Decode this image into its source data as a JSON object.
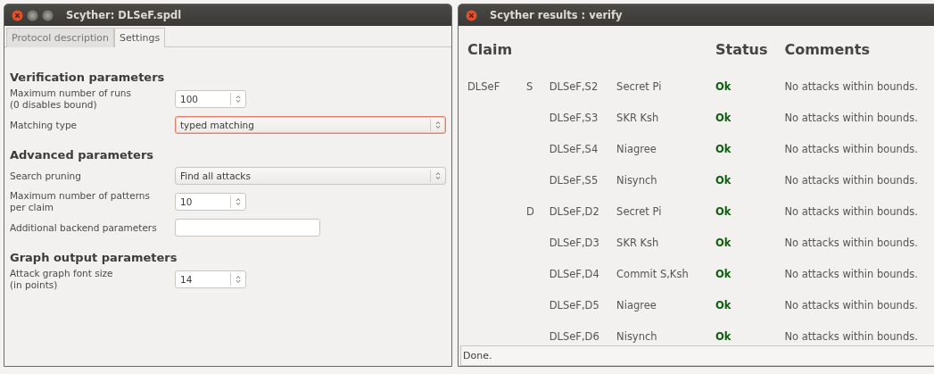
{
  "settings_window": {
    "title": "Scyther: DLSeF.spdl",
    "tabs": [
      {
        "label": "Protocol description",
        "selected": false
      },
      {
        "label": "Settings",
        "selected": true
      }
    ],
    "sections": [
      {
        "heading": "Verification parameters",
        "fields": [
          {
            "label": "Maximum number of runs\n(0 disables bound)",
            "kind": "spin",
            "value": "100",
            "focused": false
          },
          {
            "label": "Matching type",
            "kind": "combo",
            "value": "typed matching",
            "focused": true
          }
        ]
      },
      {
        "heading": "Advanced parameters",
        "fields": [
          {
            "label": "Search pruning",
            "kind": "combo",
            "value": "Find all attacks",
            "focused": false
          },
          {
            "label": "Maximum number of patterns\nper claim",
            "kind": "spin",
            "value": "10",
            "focused": false
          },
          {
            "label": "Additional backend parameters",
            "kind": "text",
            "focused": false
          }
        ]
      },
      {
        "heading": "Graph output parameters",
        "fields": [
          {
            "label": "Attack graph font size\n(in points)",
            "kind": "spin",
            "value": "14",
            "focused": false
          }
        ]
      }
    ]
  },
  "results_window": {
    "title": "Scyther results : verify",
    "columns": [
      "Claim",
      "Status",
      "Comments"
    ],
    "rows": [
      {
        "protocol": "DLSeF",
        "role": "S",
        "claim_id": "DLSeF,S2",
        "claim": "Secret Pi",
        "status": "Ok",
        "comment": "No attacks within bounds."
      },
      {
        "claim_id": "DLSeF,S3",
        "claim": "SKR Ksh",
        "status": "Ok",
        "comment": "No attacks within bounds."
      },
      {
        "claim_id": "DLSeF,S4",
        "claim": "Niagree",
        "status": "Ok",
        "comment": "No attacks within bounds."
      },
      {
        "claim_id": "DLSeF,S5",
        "claim": "Nisynch",
        "status": "Ok",
        "comment": "No attacks within bounds."
      },
      {
        "role": "D",
        "claim_id": "DLSeF,D2",
        "claim": "Secret Pi",
        "status": "Ok",
        "comment": "No attacks within bounds."
      },
      {
        "claim_id": "DLSeF,D3",
        "claim": "SKR Ksh",
        "status": "Ok",
        "comment": "No attacks within bounds."
      },
      {
        "claim_id": "DLSeF,D4",
        "claim": "Commit S,Ksh",
        "status": "Ok",
        "comment": "No attacks within bounds."
      },
      {
        "claim_id": "DLSeF,D5",
        "claim": "Niagree",
        "status": "Ok",
        "comment": "No attacks within bounds."
      },
      {
        "claim_id": "DLSeF,D6",
        "claim": "Nisynch",
        "status": "Ok",
        "comment": "No attacks within bounds."
      }
    ],
    "status_bar": "Done."
  }
}
